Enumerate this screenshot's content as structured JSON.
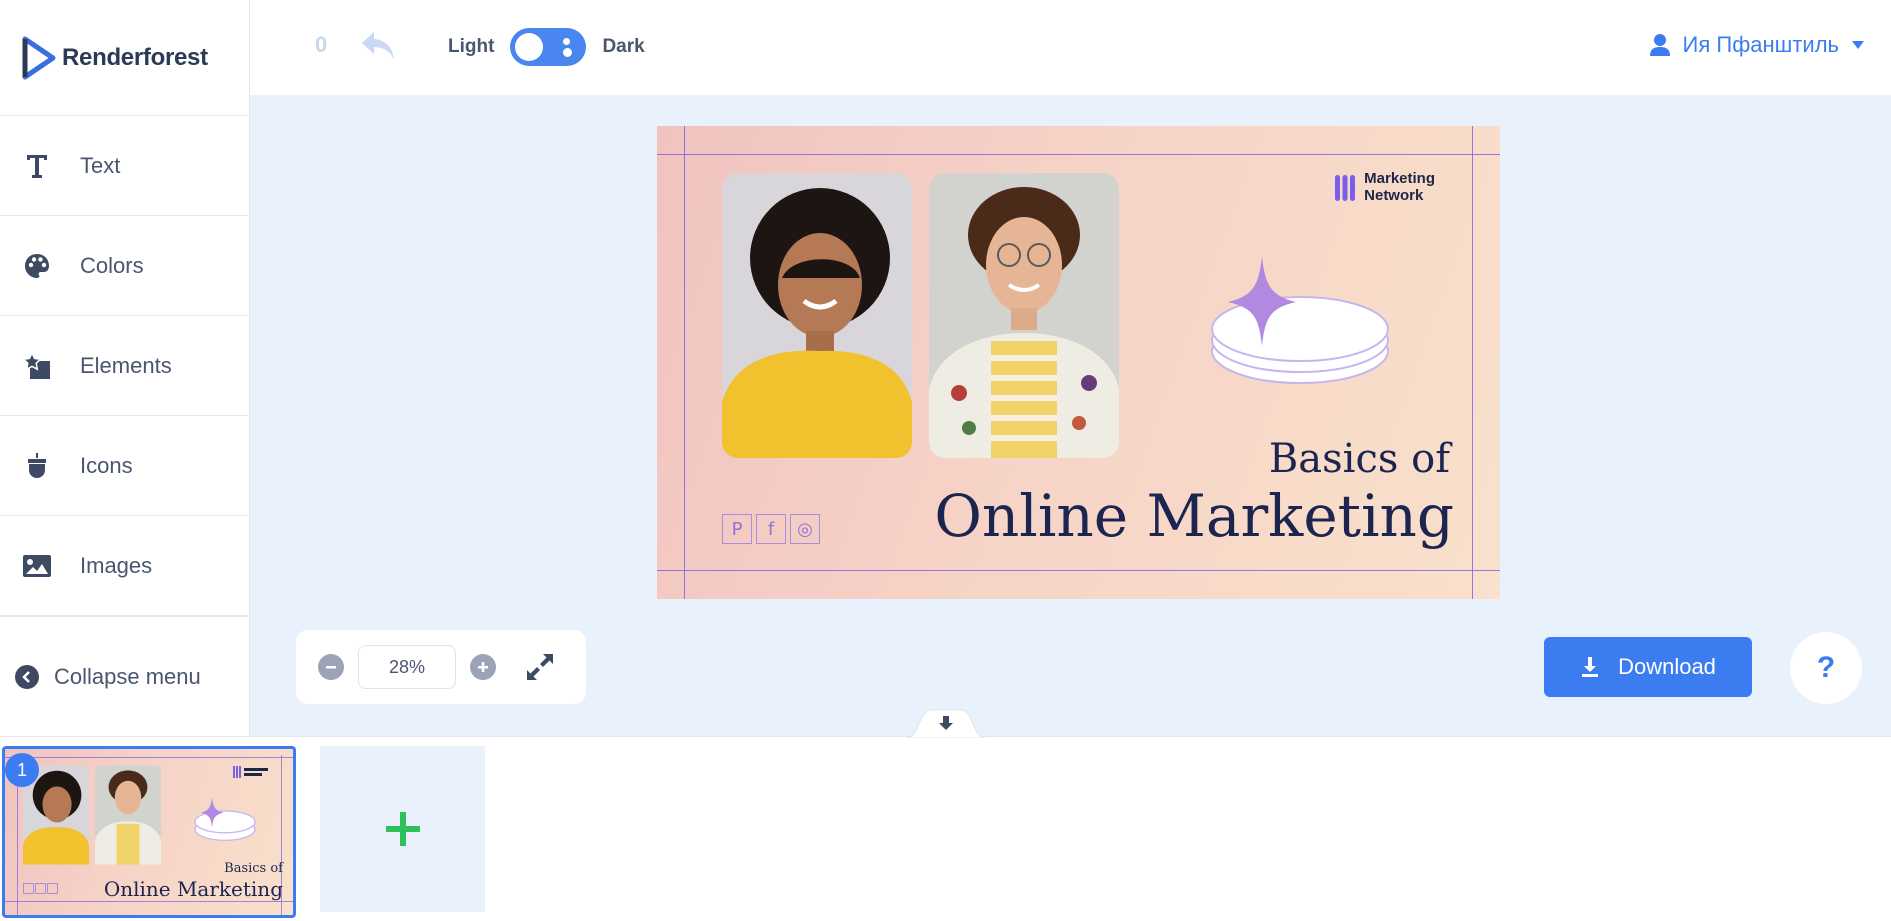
{
  "app": {
    "brand": "Renderforest"
  },
  "sidebar": {
    "items": [
      {
        "label": "Text",
        "icon": "text-icon"
      },
      {
        "label": "Colors",
        "icon": "palette-icon"
      },
      {
        "label": "Elements",
        "icon": "elements-icon"
      },
      {
        "label": "Icons",
        "icon": "acorn-icon"
      },
      {
        "label": "Images",
        "icon": "image-icon"
      }
    ],
    "collapse_label": "Collapse menu"
  },
  "topbar": {
    "undo_count": "0",
    "theme_light": "Light",
    "theme_dark": "Dark",
    "user_name": "Ия Пфанштиль"
  },
  "canvas": {
    "brand_line1": "Marketing",
    "brand_line2": "Network",
    "headline_small": "Basics of",
    "headline_large": "Online Marketing",
    "social": [
      "P",
      "f",
      "◎"
    ]
  },
  "zoom": {
    "value": "28%"
  },
  "actions": {
    "download_label": "Download",
    "help_label": "?"
  },
  "slides": [
    {
      "number": "1"
    }
  ],
  "colors": {
    "accent": "#3b7cf0",
    "add_green": "#2fbf5b",
    "purple": "#7a5ee8"
  }
}
